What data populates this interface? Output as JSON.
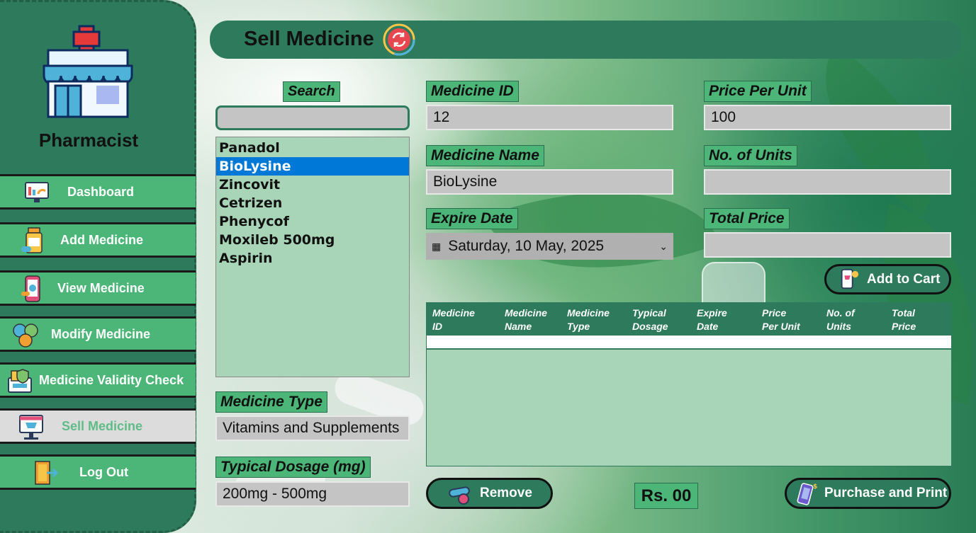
{
  "sidebar": {
    "role": "Pharmacist",
    "items": [
      {
        "label": "Dashboard",
        "icon": "dashboard-icon"
      },
      {
        "label": "Add Medicine",
        "icon": "medicine-bottle-icon"
      },
      {
        "label": "View Medicine",
        "icon": "phone-medicine-icon"
      },
      {
        "label": "Modify Medicine",
        "icon": "pills-icon"
      },
      {
        "label": "Medicine Validity Check",
        "icon": "validity-check-icon"
      },
      {
        "label": "Sell Medicine",
        "icon": "shop-cart-icon",
        "active": true
      },
      {
        "label": "Log Out",
        "icon": "logout-icon"
      }
    ]
  },
  "header": {
    "title": "Sell Medicine"
  },
  "search": {
    "label": "Search",
    "value": ""
  },
  "medicine_list": {
    "items": [
      "Panadol",
      "BioLysine",
      "Zincovit",
      "Cetrizen",
      "Phenycof",
      "Moxileb 500mg",
      "Aspirin"
    ],
    "selected": "BioLysine"
  },
  "form": {
    "medicine_id_label": "Medicine ID",
    "medicine_id": "12",
    "price_per_unit_label": "Price Per Unit",
    "price_per_unit": "100",
    "medicine_name_label": "Medicine Name",
    "medicine_name": "BioLysine",
    "units_label": "No. of Units",
    "units": "",
    "expire_date_label": "Expire Date",
    "expire_date": "Saturday, 10 May, 2025",
    "total_price_label": "Total Price",
    "total_price": "",
    "medicine_type_label": "Medicine Type",
    "medicine_type": "Vitamins and Supplements",
    "dosage_label": "Typical Dosage (mg)",
    "dosage": "200mg - 500mg"
  },
  "buttons": {
    "add_to_cart": "Add to Cart",
    "remove": "Remove",
    "purchase_print": "Purchase and Print"
  },
  "cart_table": {
    "columns": [
      [
        "Medicine",
        "ID"
      ],
      [
        "Medicine",
        "Name"
      ],
      [
        "Medicine",
        "Type"
      ],
      [
        "Typical",
        "Dosage"
      ],
      [
        "Expire",
        "Date"
      ],
      [
        "Price",
        "Per Unit"
      ],
      [
        "No. of",
        "Units"
      ],
      [
        "Total",
        "Price"
      ]
    ],
    "rows": []
  },
  "grand_total": "Rs. 00",
  "colors": {
    "sidebar": "#2e7a5d",
    "accent_green": "#4cb578",
    "selected_blue": "#0078d7",
    "list_bg": "#a8d5b7"
  }
}
